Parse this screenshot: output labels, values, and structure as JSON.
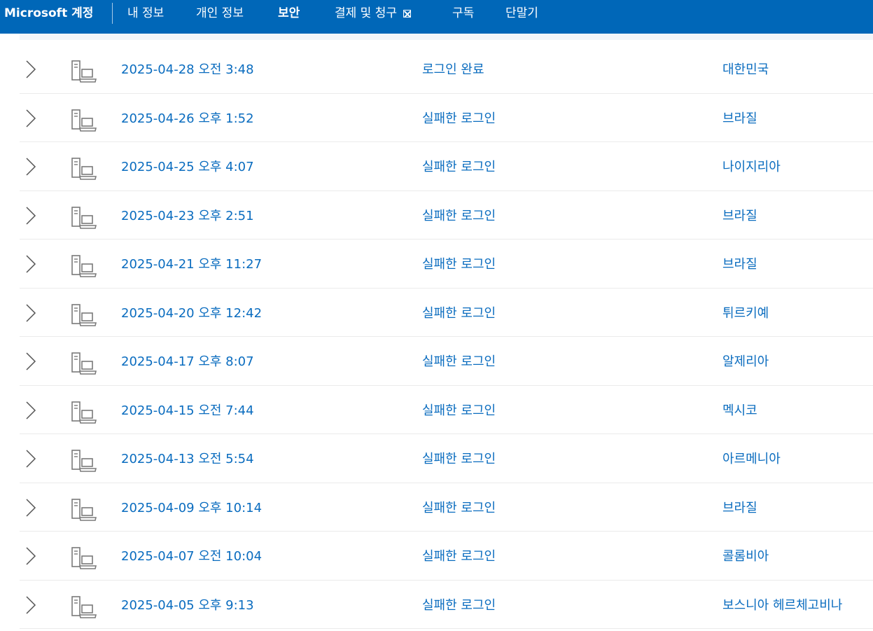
{
  "header": {
    "brand": "Microsoft 계정",
    "nav": [
      {
        "label": "내 정보",
        "active": false
      },
      {
        "label": "개인 정보",
        "active": false
      },
      {
        "label": "보안",
        "active": true
      },
      {
        "label": "결제 및 청구",
        "active": false,
        "external": true
      },
      {
        "label": "구독",
        "active": false
      },
      {
        "label": "단말기",
        "active": false
      }
    ]
  },
  "activity": {
    "rows": [
      {
        "datetime": "2025-04-28 오전 3:48",
        "status": "로그인 완료",
        "location": "대한민국"
      },
      {
        "datetime": "2025-04-26 오후 1:52",
        "status": "실패한 로그인",
        "location": "브라질"
      },
      {
        "datetime": "2025-04-25 오후 4:07",
        "status": "실패한 로그인",
        "location": "나이지리아"
      },
      {
        "datetime": "2025-04-23 오후 2:51",
        "status": "실패한 로그인",
        "location": "브라질"
      },
      {
        "datetime": "2025-04-21 오후 11:27",
        "status": "실패한 로그인",
        "location": "브라질"
      },
      {
        "datetime": "2025-04-20 오후 12:42",
        "status": "실패한 로그인",
        "location": "튀르키예"
      },
      {
        "datetime": "2025-04-17 오후 8:07",
        "status": "실패한 로그인",
        "location": "알제리아"
      },
      {
        "datetime": "2025-04-15 오전 7:44",
        "status": "실패한 로그인",
        "location": "멕시코"
      },
      {
        "datetime": "2025-04-13 오전 5:54",
        "status": "실패한 로그인",
        "location": "아르메니아"
      },
      {
        "datetime": "2025-04-09 오후 10:14",
        "status": "실패한 로그인",
        "location": "브라질"
      },
      {
        "datetime": "2025-04-07 오전 10:04",
        "status": "실패한 로그인",
        "location": "콜롬비아"
      },
      {
        "datetime": "2025-04-05 오후 9:13",
        "status": "실패한 로그인",
        "location": "보스니아 헤르체고비나"
      }
    ]
  },
  "icons": {
    "expand": "chevron-right-icon",
    "device": "desktop-laptop-icon",
    "external": "external-link-icon"
  },
  "colors": {
    "header_bg": "#0067b8",
    "link_text": "#0a6cbf",
    "divider": "#ebebeb",
    "icon_gray": "#7a7a7a"
  }
}
